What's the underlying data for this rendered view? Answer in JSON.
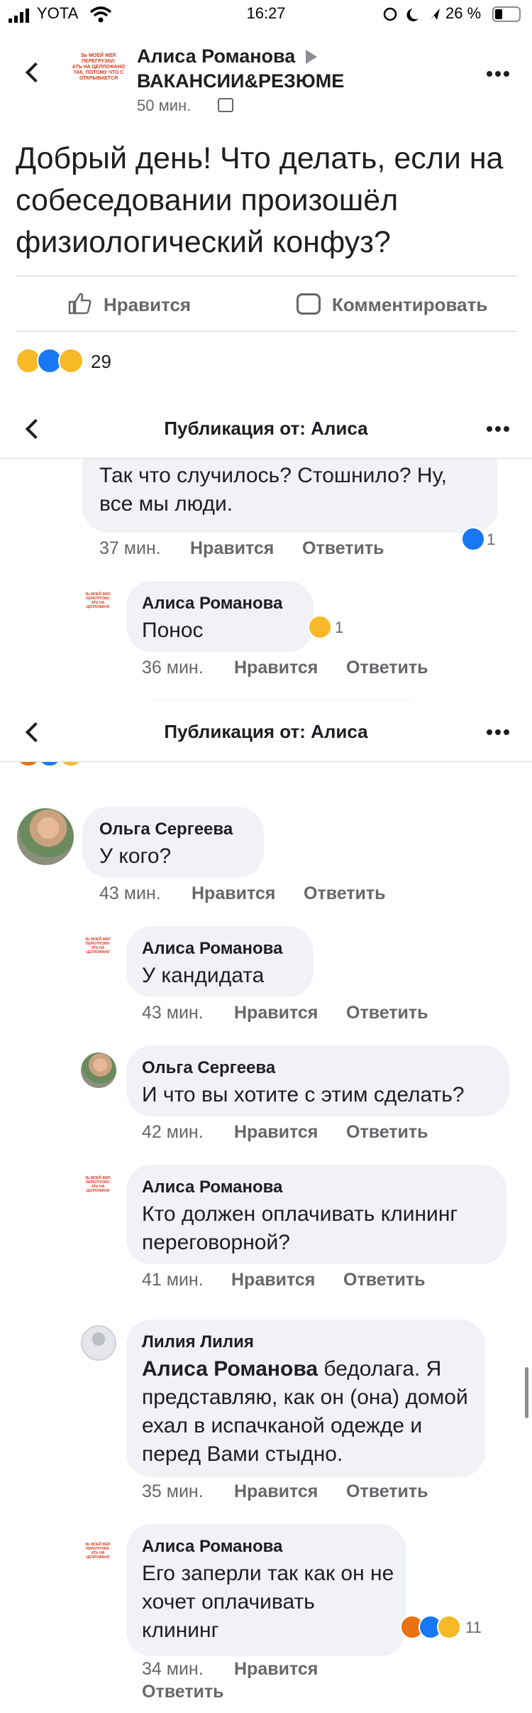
{
  "status_bar": {
    "carrier": "YOTA",
    "time": "16:27",
    "battery": "26 %"
  },
  "post_header": {
    "author": "Алиса Романова",
    "group": "ВАКАНСИИ&РЕЗЮМЕ",
    "time": "50 мин.",
    "group_logo_lines": [
      "ЗЬ МОЕЙ ЖЕР.",
      "ПЕРЕГРУЗКИ:",
      "АТЬ НА ЦЕЛЛОФАНО",
      "ТАК, ПОТОМУ ЧТО С",
      "ОТКРЫВАЕТСЯ"
    ]
  },
  "post": {
    "text": "Добрый день! Что делать, если на собеседовании произошёл физиологический конфуз?"
  },
  "actions": {
    "like": "Нравится",
    "comment": "Комментировать"
  },
  "reactions_summary": {
    "count": "29"
  },
  "navbar": {
    "title": "Публикация от: Алиса"
  },
  "comments_part1": [
    {
      "text": "Так что случилось? Стошнило? Ну, все мы люди.",
      "time": "37 мин.",
      "like": "Нравится",
      "reply": "Ответить",
      "reaction_count": "1"
    },
    {
      "author": "Алиса Романова",
      "text": "Понос",
      "time": "36 мин.",
      "like": "Нравится",
      "reply": "Ответить",
      "reaction_count": "1"
    }
  ],
  "comments_part2": [
    {
      "author": "Ольга Сергеева",
      "text": "У кого?",
      "time": "43 мин.",
      "like": "Нравится",
      "reply": "Ответить"
    },
    {
      "author": "Алиса Романова",
      "text": "У кандидата",
      "time": "43 мин.",
      "like": "Нравится",
      "reply": "Ответить"
    },
    {
      "author": "Ольга Сергеева",
      "text": "И что вы хотите с этим сделать?",
      "time": "42 мин.",
      "like": "Нравится",
      "reply": "Ответить"
    },
    {
      "author": "Алиса Романова",
      "text": "Кто должен оплачивать клининг переговорной?",
      "time": "41 мин.",
      "like": "Нравится",
      "reply": "Ответить"
    },
    {
      "author": "Лилия Лилия",
      "mention": "Алиса Романова",
      "text": " бедолага. Я представляю, как он (она) домой ехал в испачканой одежде и перед Вами стыдно.",
      "time": "35 мин.",
      "like": "Нравится",
      "reply": "Ответить"
    },
    {
      "author": "Алиса Романова",
      "text": "Его заперли так как он не хочет оплачивать клининг",
      "time": "34 мин.",
      "like": "Нравится",
      "reply": "Ответить",
      "reaction_count": "11"
    }
  ],
  "colors": {
    "fb_blue": "#1877f2",
    "bubble": "#f0f2f5",
    "secondary_text": "#65676b"
  }
}
